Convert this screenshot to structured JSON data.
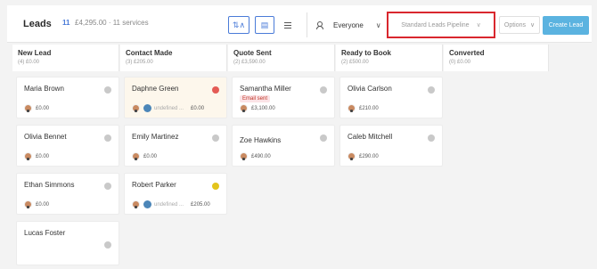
{
  "header": {
    "title": "Leads",
    "count": "11",
    "summary": "£4,295.00 · 11 services",
    "filter_user": "Everyone",
    "pipeline": "Standard Leads Pipeline",
    "options_label": "Options",
    "create_label": "Create Lead"
  },
  "columns": [
    {
      "name": "New Lead",
      "sub": "(4) £0.00"
    },
    {
      "name": "Contact Made",
      "sub": "(3) £205.00"
    },
    {
      "name": "Quote Sent",
      "sub": "(2) £3,590.00"
    },
    {
      "name": "Ready to Book",
      "sub": "(2) £500.00"
    },
    {
      "name": "Converted",
      "sub": "(0) £0.00"
    }
  ],
  "cards": {
    "c1": {
      "name": "Maria Brown",
      "amount": "£0.00"
    },
    "c2": {
      "name": "Olivia Bennet",
      "amount": "£0.00"
    },
    "c3": {
      "name": "Ethan Simmons",
      "amount": "£0.00"
    },
    "c4": {
      "name": "Lucas Foster"
    },
    "c5": {
      "name": "Daphne Green",
      "undef": "undefined ...",
      "amount": "£0.00"
    },
    "c6": {
      "name": "Emily Martinez",
      "amount": "£0.00"
    },
    "c7": {
      "name": "Robert Parker",
      "undef": "undefined ...",
      "amount": "£205.00"
    },
    "c8": {
      "name": "Samantha Miller",
      "tag": "Email sent",
      "amount": "£3,100.00"
    },
    "c9": {
      "name": "Zoe Hawkins",
      "amount": "£490.00"
    },
    "c10": {
      "name": "Olivia Carlson",
      "amount": "£210.00"
    },
    "c11": {
      "name": "Caleb Mitchell",
      "amount": "£290.00"
    }
  },
  "colors": {
    "accent": "#4a7bd8",
    "create": "#5bb3e0",
    "highlight": "#d9272e"
  }
}
